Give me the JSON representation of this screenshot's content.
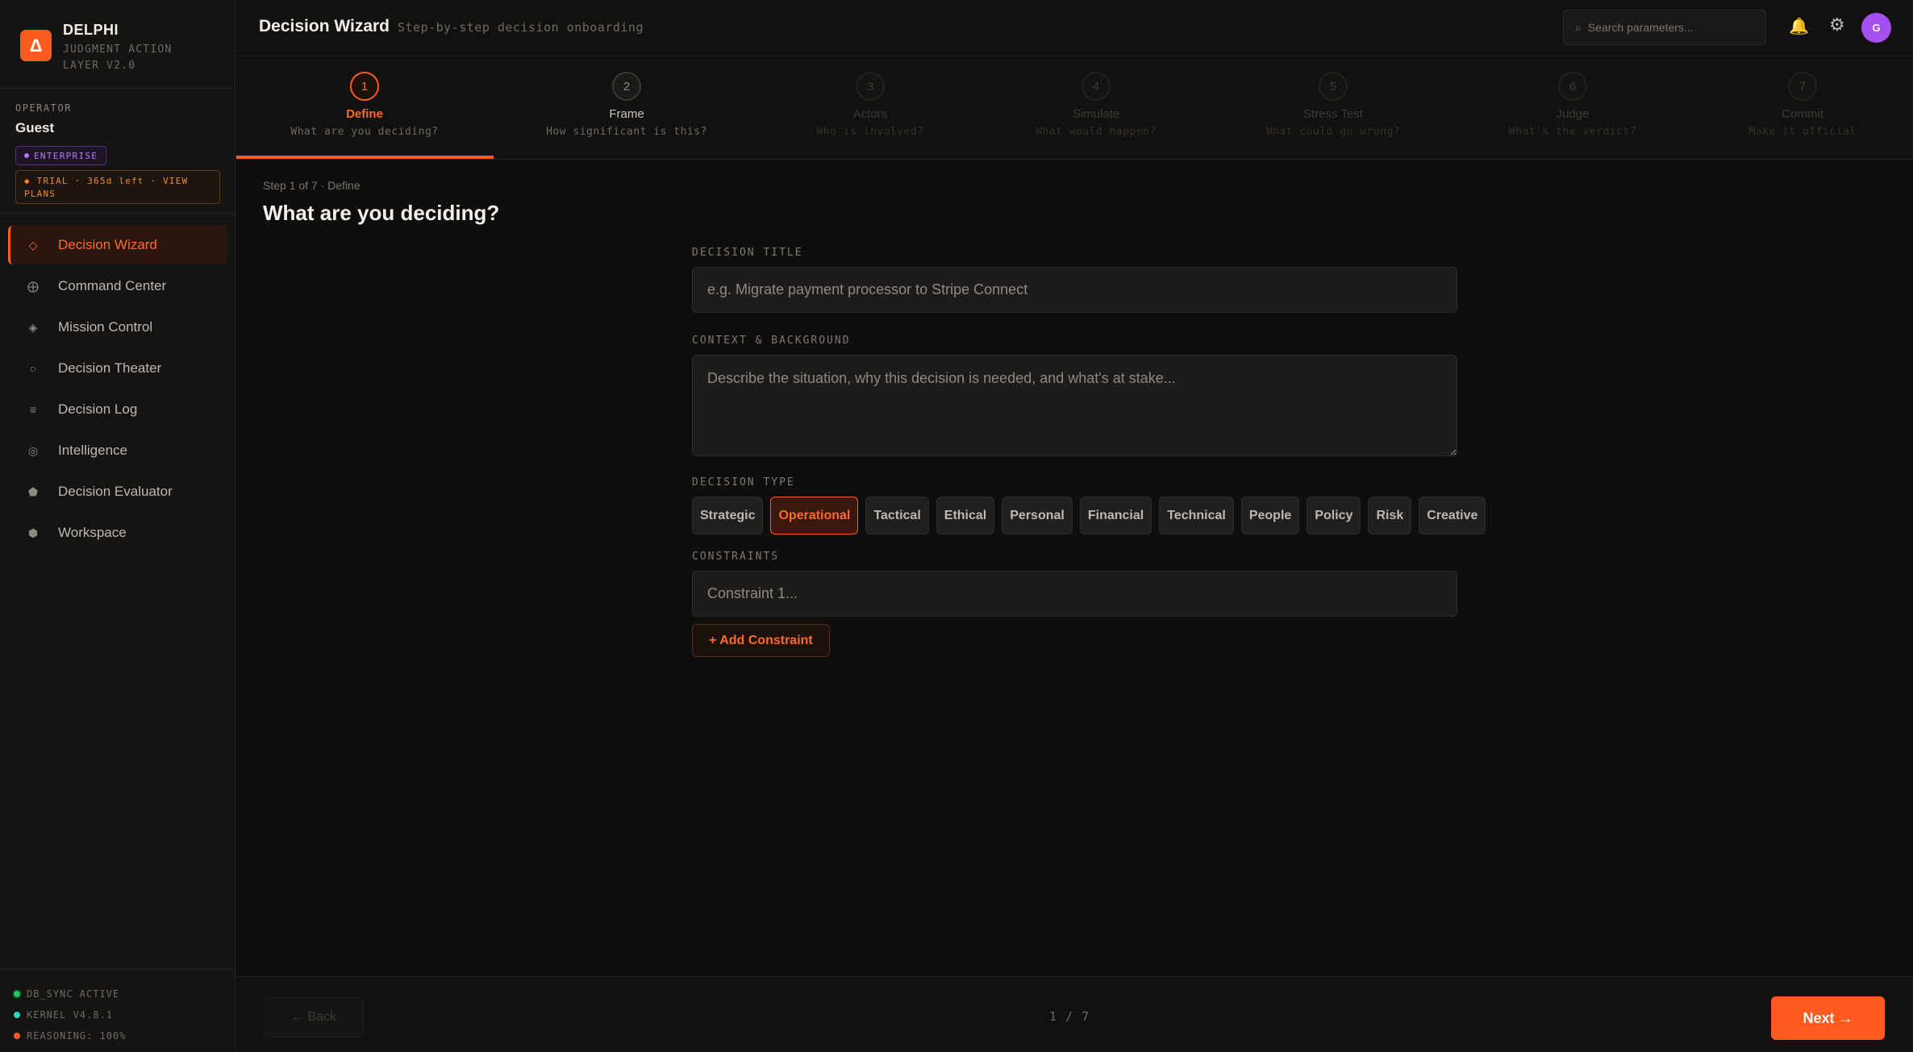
{
  "brand": {
    "logo_glyph": "Δ",
    "name": "DELPHI",
    "subtitle": "JUDGMENT ACTION LAYER V2.0",
    "accent_color": "#ff5a1f"
  },
  "operator": {
    "label": "OPERATOR",
    "name": "Guest",
    "plan_badge": "ENTERPRISE",
    "trial_text": "◆ TRIAL · 365d left · VIEW PLANS"
  },
  "sidebar": {
    "items": [
      {
        "label": "Decision Wizard",
        "icon": "◇",
        "active": true
      },
      {
        "label": "Command Center",
        "icon": "⨁"
      },
      {
        "label": "Mission Control",
        "icon": "◈"
      },
      {
        "label": "Decision Theater",
        "icon": "○"
      },
      {
        "label": "Decision Log",
        "icon": "≡"
      },
      {
        "label": "Intelligence",
        "icon": "◎"
      },
      {
        "label": "Decision Evaluator",
        "icon": "⬟"
      },
      {
        "label": "Workspace",
        "icon": "⬢"
      }
    ]
  },
  "system_status": {
    "items": [
      {
        "text": "DB_SYNC ACTIVE",
        "color": "#22c55e"
      },
      {
        "text": "KERNEL V4.8.1",
        "color": "#2dd4bf"
      },
      {
        "text": "REASONING: 100%",
        "color": "#ff5a1f"
      }
    ]
  },
  "header": {
    "title": "Decision Wizard",
    "subtitle": "Step-by-step decision onboarding",
    "search_placeholder": "Search parameters...",
    "avatar_initial": "G"
  },
  "stepper": {
    "steps": [
      {
        "num": "1",
        "label": "Define",
        "sub": "What are you deciding?",
        "state": "active"
      },
      {
        "num": "2",
        "label": "Frame",
        "sub": "How significant is this?",
        "state": "next"
      },
      {
        "num": "3",
        "label": "Actors",
        "sub": "Who is involved?",
        "state": "dim"
      },
      {
        "num": "4",
        "label": "Simulate",
        "sub": "What would happen?",
        "state": "dim"
      },
      {
        "num": "5",
        "label": "Stress Test",
        "sub": "What could go wrong?",
        "state": "dim"
      },
      {
        "num": "6",
        "label": "Judge",
        "sub": "What's the verdict?",
        "state": "dim"
      },
      {
        "num": "7",
        "label": "Commit",
        "sub": "Make it official",
        "state": "dim"
      }
    ]
  },
  "main": {
    "breadcrumb": "Step 1 of 7 · Define",
    "title": "What are you deciding?",
    "form": {
      "title_label": "DECISION TITLE",
      "title_placeholder": "e.g. Migrate payment processor to Stripe Connect",
      "title_value": "",
      "context_label": "CONTEXT & BACKGROUND",
      "context_placeholder": "Describe the situation, why this decision is needed, and what's at stake...",
      "context_value": "",
      "type_label": "DECISION TYPE",
      "types": [
        "Strategic",
        "Operational",
        "Tactical",
        "Ethical",
        "Personal",
        "Financial",
        "Technical",
        "People",
        "Policy",
        "Risk",
        "Creative"
      ],
      "selected_type": "Operational",
      "constraints_label": "CONSTRAINTS",
      "constraint_placeholder": "Constraint 1...",
      "add_constraint_label": "+ Add Constraint"
    }
  },
  "footer": {
    "back_label": "← Back",
    "pager": "1 / 7",
    "next_label": "Next →"
  }
}
